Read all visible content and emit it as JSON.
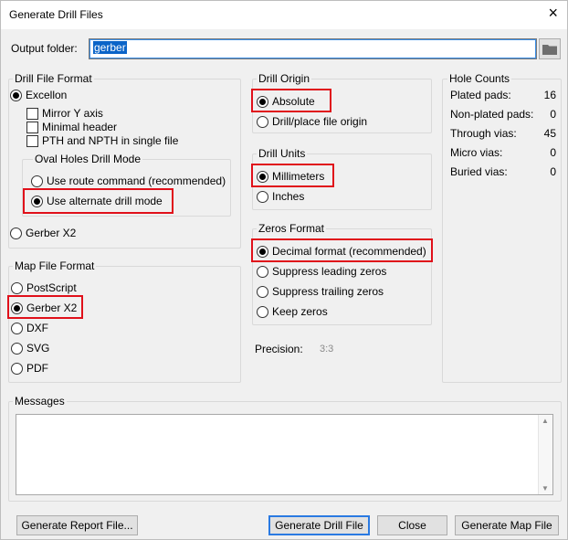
{
  "window": {
    "title": "Generate Drill Files",
    "close_icon": "×"
  },
  "output": {
    "label": "Output folder:",
    "value": "gerber"
  },
  "drill_file_format": {
    "title": "Drill File Format",
    "excellon": "Excellon",
    "mirror_y": "Mirror Y axis",
    "minimal_header": "Minimal header",
    "pth_npth": "PTH and NPTH in single file",
    "oval_holes": {
      "title": "Oval Holes Drill Mode",
      "route": "Use route command (recommended)",
      "alternate": "Use alternate drill mode"
    },
    "gerber_x2": "Gerber X2"
  },
  "map_file_format": {
    "title": "Map File Format",
    "options": [
      "PostScript",
      "Gerber X2",
      "DXF",
      "SVG",
      "PDF"
    ]
  },
  "drill_origin": {
    "title": "Drill Origin",
    "absolute": "Absolute",
    "place": "Drill/place file origin"
  },
  "drill_units": {
    "title": "Drill Units",
    "mm": "Millimeters",
    "inches": "Inches"
  },
  "zeros_format": {
    "title": "Zeros Format",
    "decimal": "Decimal format (recommended)",
    "leading": "Suppress leading zeros",
    "trailing": "Suppress trailing zeros",
    "keep": "Keep zeros"
  },
  "precision": {
    "label": "Precision:",
    "value": "3:3"
  },
  "hole_counts": {
    "title": "Hole Counts",
    "rows": [
      {
        "label": "Plated pads:",
        "value": "16"
      },
      {
        "label": "Non-plated pads:",
        "value": "0"
      },
      {
        "label": "Through vias:",
        "value": "45"
      },
      {
        "label": "Micro vias:",
        "value": "0"
      },
      {
        "label": "Buried vias:",
        "value": "0"
      }
    ]
  },
  "messages": {
    "title": "Messages"
  },
  "buttons": {
    "report": "Generate Report File...",
    "drill": "Generate Drill File",
    "close": "Close",
    "map": "Generate Map File"
  },
  "colors": {
    "highlight": "#e0101a",
    "selection": "#0a64c8"
  }
}
